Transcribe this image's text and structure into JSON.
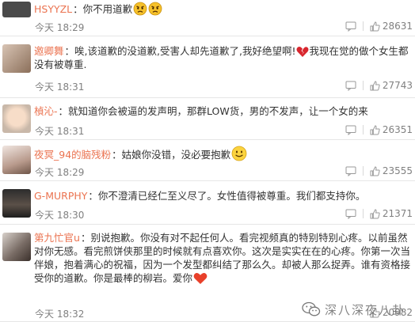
{
  "comments": [
    {
      "username": "HSYYZL",
      "separator": "：",
      "text": "你不用道歉",
      "text2": "",
      "emoji": [
        "angry-face-emoji",
        "angry-face-emoji"
      ],
      "time": "今天 18:29",
      "likes": "28631"
    },
    {
      "username": "邀卿舞",
      "separator": "：",
      "text": "唉,该道歉的没道歉,受害人却先道歉了,我好绝望啊!",
      "text2": "我现在觉的做个女生都没有被尊重.",
      "emoji": [
        "broken-heart-emoji"
      ],
      "time": "今天 18:31",
      "likes": "27743"
    },
    {
      "username": "楨沁-",
      "separator": "：",
      "text": "就知道你会被逼的发声明，那群LOW货，男的不发声，让一个女的来",
      "text2": "",
      "emoji": [],
      "time": "今天 18:31",
      "likes": "26351"
    },
    {
      "username": "夜冥_94的脑残粉",
      "separator": "：",
      "text": "姑娘你没错，没必要抱歉",
      "text2": "",
      "emoji": [
        "smile-face-emoji"
      ],
      "time": "今天 18:29",
      "likes": "23555"
    },
    {
      "username": "G-MURPHY",
      "separator": "：",
      "text": "你不澄清已经仁至义尽了。女性值得被尊重。我们都支持你。",
      "text2": "",
      "emoji": [],
      "time": "今天 18:30",
      "likes": "21371"
    },
    {
      "username": "第九忙官u",
      "separator": "：",
      "text": "别说抱歉。你没有对不起任何人。看完视频真的特别特别心疼。以前虽然对你无感。看完煎饼侠那里的时候就有点喜欢你。这次是实实在在的心疼。你第一次当伴娘，抱着满心的祝福，因为一个发型都纠结了那么久。却被人那么捉弄。谁有资格接受你的道歉。你是最棒的柳岩。爱你",
      "text2": "",
      "emoji": [
        "heart-emoji"
      ],
      "time": "今天 18:32",
      "likes": "20982"
    }
  ],
  "watermark": {
    "text": "深八深夜八卦",
    "icon": "wechat-icon"
  },
  "colors": {
    "username": "#eb7350",
    "text": "#333333",
    "meta": "#808080",
    "divider": "#e6e6e6"
  }
}
